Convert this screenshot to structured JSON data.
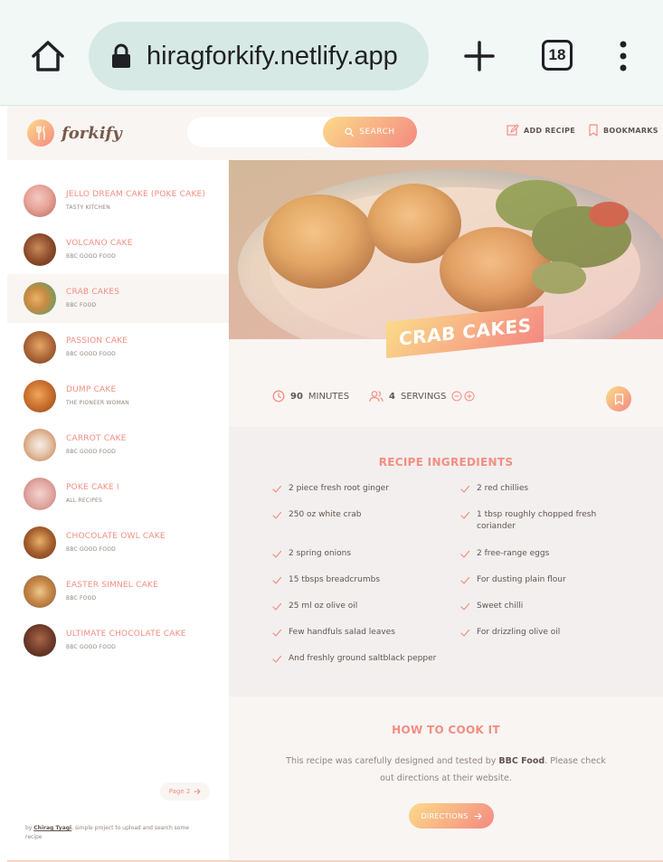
{
  "browser": {
    "url": "hiragforkify.netlify.app",
    "tab_count": "18"
  },
  "header": {
    "logo_text": "forkify",
    "search_button": "SEARCH",
    "search_value": "",
    "add_recipe": "ADD RECIPE",
    "bookmarks": "BOOKMARKS"
  },
  "sidebar": {
    "results": [
      {
        "title": "JELLO DREAM CAKE (POKE CAKE)",
        "publisher": "TASTY KITCHEN"
      },
      {
        "title": "VOLCANO CAKE",
        "publisher": "BBC GOOD FOOD"
      },
      {
        "title": "CRAB CAKES",
        "publisher": "BBC FOOD"
      },
      {
        "title": "PASSION CAKE",
        "publisher": "BBC GOOD FOOD"
      },
      {
        "title": "DUMP CAKE",
        "publisher": "THE PIONEER WOMAN"
      },
      {
        "title": "CARROT CAKE",
        "publisher": "BBC GOOD FOOD"
      },
      {
        "title": "POKE CAKE I",
        "publisher": "ALL RECIPES"
      },
      {
        "title": "CHOCOLATE OWL CAKE",
        "publisher": "BBC GOOD FOOD"
      },
      {
        "title": "EASTER SIMNEL CAKE",
        "publisher": "BBC FOOD"
      },
      {
        "title": "ULTIMATE CHOCOLATE CAKE",
        "publisher": "BBC GOOD FOOD"
      }
    ],
    "pagination_next": "Page 2",
    "copyright_by": "by",
    "copyright_author": "Chirag Tyagi",
    "copyright_rest": ", simple project to upload and search some recipe"
  },
  "recipe": {
    "title": "CRAB CAKES",
    "minutes_value": "90",
    "minutes_label": "MINUTES",
    "servings_value": "4",
    "servings_label": "SERVINGS",
    "ingredients_heading": "RECIPE INGREDIENTS",
    "ingredients": [
      "2 piece fresh root ginger",
      "2 red chillies",
      "250 oz white crab",
      "1 tbsp roughly chopped fresh coriander",
      "2 spring onions",
      "2 free-range eggs",
      "15 tbsps breadcrumbs",
      "For dusting plain flour",
      "25 ml oz olive oil",
      "Sweet chilli",
      "Few handfuls salad leaves",
      "For drizzling olive oil",
      "And freshly ground saltblack pepper"
    ],
    "cook_heading": "HOW TO COOK IT",
    "cook_text_before": "This recipe was carefully designed and tested by ",
    "cook_publisher": "BBC Food",
    "cook_text_after": ". Please check out directions at their website.",
    "directions_button": "DIRECTIONS"
  },
  "colors": {
    "accent": "#f38e82",
    "gradient_start": "#fbdb89",
    "gradient_end": "#f48982",
    "background": "#f9f5f3",
    "text": "#615551"
  },
  "icons": [
    "home-icon",
    "lock-icon",
    "plus-icon",
    "tabs-icon",
    "menu-icon",
    "search-icon",
    "edit-icon",
    "bookmark-icon",
    "clock-icon",
    "users-icon",
    "minus-circle-icon",
    "plus-circle-icon",
    "check-icon",
    "arrow-right-icon"
  ]
}
